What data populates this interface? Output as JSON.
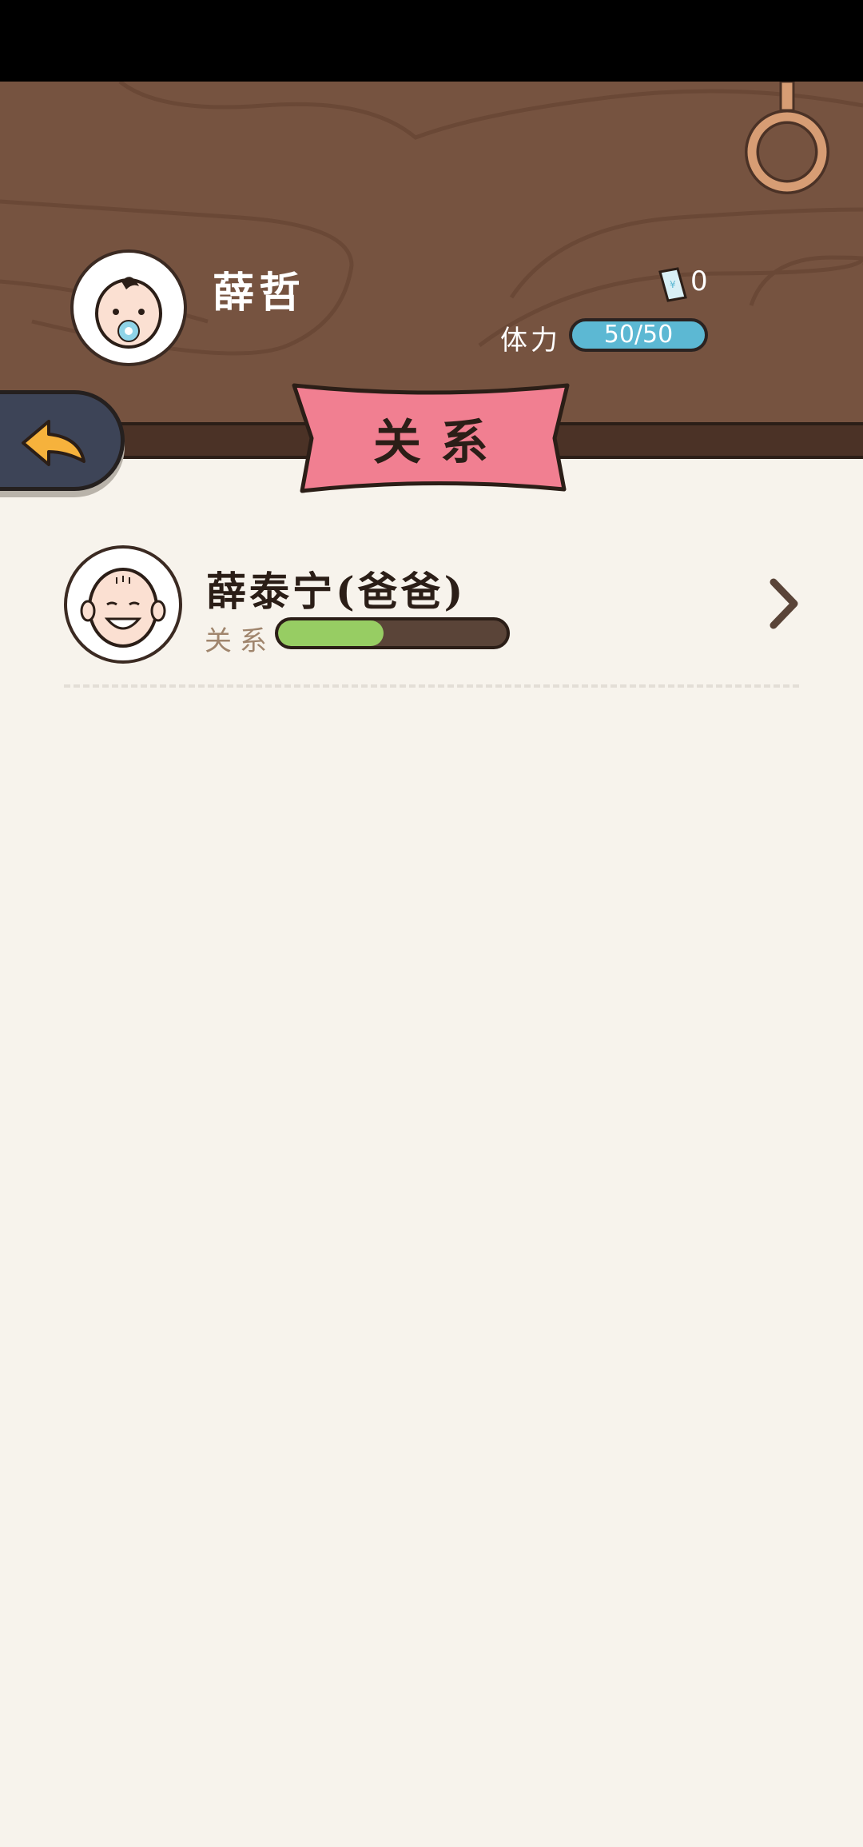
{
  "header": {
    "player_name": "薛哲",
    "tickets": "0",
    "stamina_label": "体力",
    "stamina": "50/50"
  },
  "page_title": "关系",
  "relationships": [
    {
      "name": "薛泰宁(爸爸)",
      "bar_label": "关系",
      "level_fraction": 0.46
    }
  ],
  "colors": {
    "wood": "#765340",
    "banner": "#f17f91",
    "stamina": "#5cb8d3",
    "relationship_fill": "#97cd63",
    "background": "#f7f3ec"
  },
  "icons": [
    "pacifier-baby-avatar",
    "ticket-icon",
    "back-arrow-icon",
    "hanging-ring-icon",
    "dad-avatar",
    "chevron-right-icon"
  ]
}
